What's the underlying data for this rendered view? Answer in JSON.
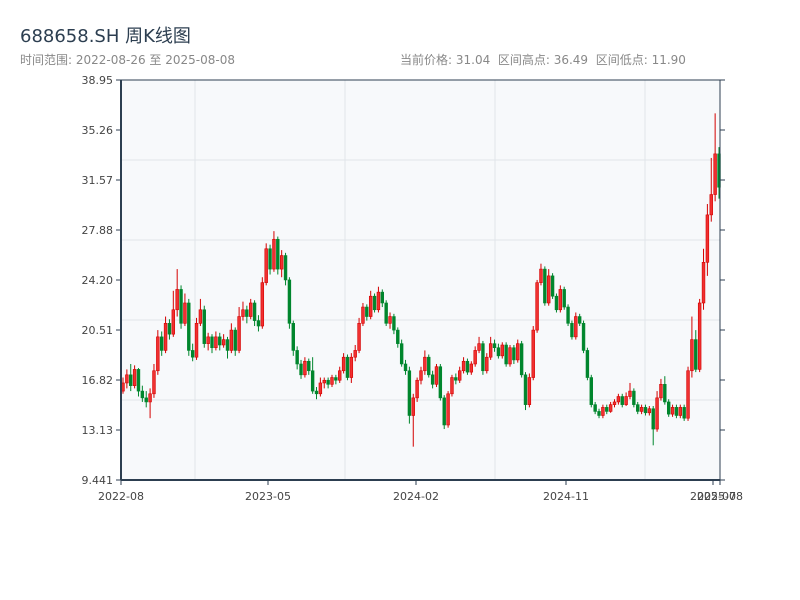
{
  "header": {
    "title": "688658.SH 周K线图",
    "range": "时间范围: 2022-08-26 至 2025-08-08",
    "current_price": "当前价格: 31.04",
    "range_high": "区间高点: 36.49",
    "range_low": "区间低点: 11.90"
  },
  "chart_data": {
    "type": "candlestick",
    "start_date": "2022-08-26",
    "end_date": "2025-08-08",
    "frequency": "weekly",
    "ylim": [
      9.441,
      38.95
    ],
    "yticks": [
      "9.441",
      "13.13",
      "16.82",
      "20.51",
      "24.20",
      "27.88",
      "31.57",
      "35.26",
      "38.95"
    ],
    "xticks": [
      "2022-08",
      "2023-05",
      "2024-02",
      "2024-11",
      "2025-07",
      "2025-08"
    ],
    "grid": true,
    "colors": {
      "up": "#d40000",
      "down": "#00862d",
      "background": "#f7f9fb",
      "axis": "#2c3e50"
    },
    "ohlc": [
      [
        16.0,
        17.0,
        15.8,
        16.6
      ],
      [
        16.6,
        17.6,
        16.2,
        17.2
      ],
      [
        17.2,
        18.0,
        16.0,
        16.4
      ],
      [
        16.4,
        17.9,
        16.2,
        17.6
      ],
      [
        17.6,
        17.7,
        15.6,
        16.0
      ],
      [
        16.0,
        16.4,
        15.2,
        15.5
      ],
      [
        15.5,
        16.0,
        14.8,
        15.2
      ],
      [
        15.2,
        16.2,
        14.0,
        15.8
      ],
      [
        15.8,
        18.0,
        15.5,
        17.5
      ],
      [
        17.5,
        20.5,
        17.2,
        20.0
      ],
      [
        20.0,
        20.4,
        18.6,
        19.0
      ],
      [
        19.0,
        21.5,
        18.8,
        21.0
      ],
      [
        21.0,
        21.3,
        19.8,
        20.2
      ],
      [
        20.2,
        23.4,
        20.0,
        22.0
      ],
      [
        22.0,
        25.0,
        21.5,
        23.5
      ],
      [
        23.5,
        23.8,
        20.6,
        21.0
      ],
      [
        21.0,
        23.2,
        20.8,
        22.5
      ],
      [
        22.5,
        22.8,
        18.6,
        19.0
      ],
      [
        19.0,
        19.5,
        18.2,
        18.5
      ],
      [
        18.5,
        21.4,
        18.3,
        21.0
      ],
      [
        21.0,
        22.8,
        20.8,
        22.0
      ],
      [
        22.0,
        22.3,
        19.2,
        19.5
      ],
      [
        19.5,
        20.3,
        19.0,
        20.0
      ],
      [
        20.0,
        20.2,
        18.8,
        19.2
      ],
      [
        19.2,
        20.4,
        19.0,
        20.0
      ],
      [
        20.0,
        20.3,
        19.0,
        19.4
      ],
      [
        19.4,
        20.2,
        19.2,
        19.8
      ],
      [
        19.8,
        20.0,
        18.4,
        19.0
      ],
      [
        19.0,
        21.0,
        18.8,
        20.5
      ],
      [
        20.5,
        20.7,
        18.6,
        19.0
      ],
      [
        19.0,
        22.2,
        18.8,
        21.5
      ],
      [
        21.5,
        22.6,
        21.2,
        22.0
      ],
      [
        22.0,
        22.3,
        21.0,
        21.5
      ],
      [
        21.5,
        22.8,
        21.3,
        22.5
      ],
      [
        22.5,
        22.7,
        20.8,
        21.2
      ],
      [
        21.2,
        21.6,
        20.4,
        20.8
      ],
      [
        20.8,
        24.4,
        20.6,
        24.0
      ],
      [
        24.0,
        26.9,
        23.8,
        26.5
      ],
      [
        26.5,
        26.8,
        24.6,
        25.0
      ],
      [
        25.0,
        27.8,
        24.8,
        27.2
      ],
      [
        27.2,
        27.4,
        24.6,
        25.0
      ],
      [
        25.0,
        26.4,
        24.4,
        26.0
      ],
      [
        26.0,
        26.2,
        23.8,
        24.2
      ],
      [
        24.2,
        24.4,
        20.6,
        21.0
      ],
      [
        21.0,
        21.2,
        18.6,
        19.0
      ],
      [
        19.0,
        19.3,
        17.6,
        18.0
      ],
      [
        18.0,
        18.3,
        16.9,
        17.2
      ],
      [
        17.2,
        18.5,
        17.0,
        18.2
      ],
      [
        18.2,
        18.4,
        17.2,
        17.5
      ],
      [
        17.5,
        18.5,
        15.8,
        16.0
      ],
      [
        16.0,
        16.3,
        15.4,
        15.8
      ],
      [
        15.8,
        17.0,
        15.6,
        16.6
      ],
      [
        16.6,
        17.0,
        16.2,
        16.8
      ],
      [
        16.8,
        17.0,
        16.2,
        16.5
      ],
      [
        16.5,
        17.2,
        16.3,
        17.0
      ],
      [
        17.0,
        17.2,
        16.5,
        16.8
      ],
      [
        16.8,
        17.8,
        16.6,
        17.5
      ],
      [
        17.5,
        18.8,
        17.3,
        18.5
      ],
      [
        18.5,
        18.7,
        16.8,
        17.0
      ],
      [
        17.0,
        18.8,
        16.6,
        18.5
      ],
      [
        18.5,
        19.4,
        18.2,
        19.0
      ],
      [
        19.0,
        21.4,
        18.8,
        21.0
      ],
      [
        21.0,
        22.5,
        20.8,
        22.2
      ],
      [
        22.2,
        22.4,
        21.2,
        21.5
      ],
      [
        21.5,
        23.4,
        21.3,
        23.0
      ],
      [
        23.0,
        23.2,
        21.8,
        22.0
      ],
      [
        22.0,
        23.7,
        21.8,
        23.3
      ],
      [
        23.3,
        23.5,
        22.2,
        22.5
      ],
      [
        22.5,
        22.7,
        20.8,
        21.0
      ],
      [
        21.0,
        21.8,
        20.6,
        21.5
      ],
      [
        21.5,
        21.7,
        20.2,
        20.5
      ],
      [
        20.5,
        20.7,
        19.2,
        19.5
      ],
      [
        19.5,
        19.8,
        17.8,
        18.0
      ],
      [
        18.0,
        18.3,
        17.2,
        17.5
      ],
      [
        17.5,
        17.8,
        13.6,
        14.2
      ],
      [
        14.2,
        15.8,
        11.9,
        15.5
      ],
      [
        15.5,
        17.0,
        15.2,
        16.8
      ],
      [
        16.8,
        17.8,
        16.5,
        17.5
      ],
      [
        17.5,
        19.0,
        17.2,
        18.5
      ],
      [
        18.5,
        18.7,
        17.0,
        17.2
      ],
      [
        17.2,
        17.5,
        16.2,
        16.5
      ],
      [
        16.5,
        18.0,
        16.3,
        17.8
      ],
      [
        17.8,
        18.0,
        15.3,
        15.5
      ],
      [
        15.5,
        15.7,
        13.2,
        13.5
      ],
      [
        13.5,
        16.0,
        13.3,
        15.8
      ],
      [
        15.8,
        17.2,
        15.6,
        17.0
      ],
      [
        17.0,
        17.3,
        16.5,
        16.8
      ],
      [
        16.8,
        17.8,
        16.6,
        17.5
      ],
      [
        17.5,
        18.5,
        17.3,
        18.2
      ],
      [
        18.2,
        18.4,
        17.2,
        17.4
      ],
      [
        17.4,
        18.2,
        17.2,
        18.0
      ],
      [
        18.0,
        19.3,
        17.8,
        19.0
      ],
      [
        19.0,
        20.0,
        18.8,
        19.5
      ],
      [
        19.5,
        19.7,
        17.2,
        17.5
      ],
      [
        17.5,
        18.8,
        17.3,
        18.5
      ],
      [
        18.5,
        20.0,
        18.3,
        19.5
      ],
      [
        19.5,
        19.8,
        18.9,
        19.2
      ],
      [
        19.2,
        19.5,
        18.4,
        18.6
      ],
      [
        18.6,
        19.6,
        18.4,
        19.4
      ],
      [
        19.4,
        19.6,
        17.8,
        18.0
      ],
      [
        18.0,
        19.4,
        17.8,
        19.2
      ],
      [
        19.2,
        19.4,
        18.0,
        18.3
      ],
      [
        18.3,
        19.8,
        18.1,
        19.5
      ],
      [
        19.5,
        19.7,
        17.0,
        17.2
      ],
      [
        17.2,
        17.4,
        14.6,
        15.0
      ],
      [
        15.0,
        17.3,
        14.8,
        17.0
      ],
      [
        17.0,
        20.8,
        16.8,
        20.5
      ],
      [
        20.5,
        24.2,
        20.3,
        24.0
      ],
      [
        24.0,
        25.4,
        23.8,
        25.0
      ],
      [
        25.0,
        25.2,
        22.3,
        22.5
      ],
      [
        22.5,
        25.0,
        22.3,
        24.5
      ],
      [
        24.5,
        24.7,
        22.8,
        23.0
      ],
      [
        23.0,
        23.2,
        21.8,
        22.0
      ],
      [
        22.0,
        23.8,
        21.8,
        23.5
      ],
      [
        23.5,
        23.7,
        22.0,
        22.2
      ],
      [
        22.2,
        22.4,
        20.8,
        21.0
      ],
      [
        21.0,
        21.2,
        19.8,
        20.0
      ],
      [
        20.0,
        21.8,
        19.8,
        21.5
      ],
      [
        21.5,
        21.7,
        20.8,
        21.0
      ],
      [
        21.0,
        21.2,
        18.8,
        19.0
      ],
      [
        19.0,
        19.2,
        16.8,
        17.0
      ],
      [
        17.0,
        17.2,
        14.8,
        15.0
      ],
      [
        15.0,
        15.2,
        14.3,
        14.5
      ],
      [
        14.5,
        14.7,
        14.0,
        14.2
      ],
      [
        14.2,
        15.0,
        14.0,
        14.8
      ],
      [
        14.8,
        15.0,
        14.3,
        14.5
      ],
      [
        14.5,
        15.2,
        14.4,
        15.0
      ],
      [
        15.0,
        15.4,
        14.8,
        15.2
      ],
      [
        15.2,
        15.8,
        15.0,
        15.6
      ],
      [
        15.6,
        15.8,
        14.8,
        15.0
      ],
      [
        15.0,
        15.9,
        14.9,
        15.6
      ],
      [
        15.6,
        16.6,
        15.4,
        16.0
      ],
      [
        16.0,
        16.2,
        14.8,
        15.0
      ],
      [
        15.0,
        15.2,
        14.3,
        14.5
      ],
      [
        14.5,
        15.0,
        14.3,
        14.8
      ],
      [
        14.8,
        15.0,
        14.2,
        14.4
      ],
      [
        14.4,
        14.9,
        14.2,
        14.7
      ],
      [
        14.7,
        14.9,
        12.0,
        13.2
      ],
      [
        13.2,
        16.0,
        13.0,
        15.5
      ],
      [
        15.5,
        16.9,
        15.3,
        16.5
      ],
      [
        16.5,
        17.1,
        15.0,
        15.2
      ],
      [
        15.2,
        15.4,
        14.1,
        14.3
      ],
      [
        14.3,
        15.0,
        14.1,
        14.8
      ],
      [
        14.8,
        15.0,
        14.0,
        14.2
      ],
      [
        14.2,
        15.0,
        14.0,
        14.8
      ],
      [
        14.8,
        15.0,
        13.8,
        14.0
      ],
      [
        14.0,
        17.8,
        13.8,
        17.5
      ],
      [
        17.5,
        21.5,
        17.0,
        19.8
      ],
      [
        19.8,
        20.5,
        17.4,
        17.6
      ],
      [
        17.6,
        22.8,
        17.4,
        22.5
      ],
      [
        22.5,
        26.5,
        22.0,
        25.5
      ],
      [
        25.5,
        29.8,
        24.5,
        29.0
      ],
      [
        29.0,
        33.2,
        28.5,
        30.5
      ],
      [
        30.5,
        36.49,
        30.0,
        33.5
      ],
      [
        33.5,
        34.0,
        30.2,
        31.04
      ]
    ]
  }
}
